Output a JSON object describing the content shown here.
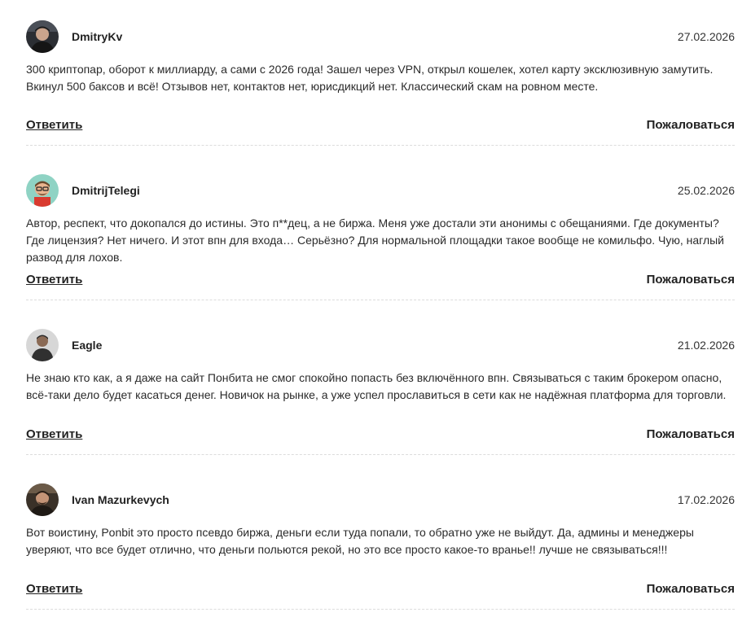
{
  "comments": [
    {
      "author": "DmitryKv",
      "date": "27.02.2026",
      "avatar": "user-avatar-photo",
      "text": "300 криптопар, оборот к миллиарду, а сами с 2026 года! Зашел через VPN, открыл кошелек, хотел карту эксклюзивную замутить.\nВкинул 500 баксов и всё! Отзывов нет, контактов нет, юрисдикций нет. Классический скам на ровном месте.",
      "reply_label": "Ответить",
      "report_label": "Пожаловаться"
    },
    {
      "author": "DmitrijTelegi",
      "date": "25.02.2026",
      "avatar": "user-avatar-cartoon",
      "text": "Автор, респект, что докопался до истины. Это п**дец, а не биржа. Меня уже достали эти анонимы с обещаниями. Где документы?\nГде лицензия? Нет ничего. И этот впн для входа… Серьёзно? Для нормальной площадки такое вообще не комильфо. Чую, наглый\nразвод для лохов.",
      "reply_label": "Ответить",
      "report_label": "Пожаловаться"
    },
    {
      "author": "Eagle",
      "date": "21.02.2026",
      "avatar": "user-avatar-photo",
      "text": "Не знаю кто как, а я даже на сайт Понбита не смог спокойно попасть без включённого впн. Связываться с таким брокером опасно,\nвсё-таки дело будет касаться денег. Новичок на рынке, а уже успел прославиться в сети как не надёжная платформа для торговли.",
      "reply_label": "Ответить",
      "report_label": "Пожаловаться"
    },
    {
      "author": "Ivan Mazurkevych",
      "date": "17.02.2026",
      "avatar": "user-avatar-photo",
      "text": "Вот воистину, Ponbit это просто псевдо биржа, деньги если туда попали, то обратно уже не выйдут. Да, админы и менеджеры\nуверяют, что все будет отлично, что деньги польются рекой, но это все просто какое-то вранье!! лучше не связываться!!!",
      "reply_label": "Ответить",
      "report_label": "Пожаловаться"
    }
  ]
}
